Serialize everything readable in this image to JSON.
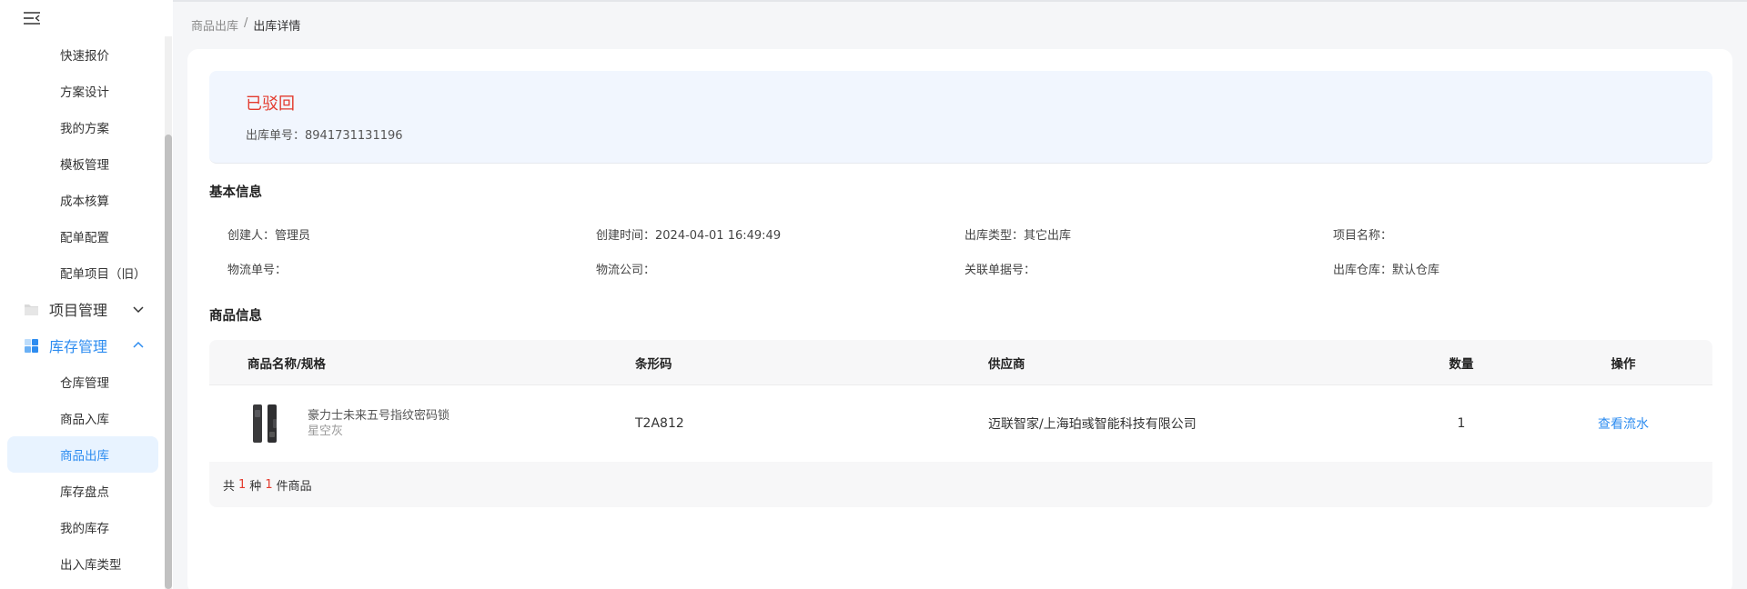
{
  "sidebar": {
    "items_top": [
      {
        "label": "快速报价"
      },
      {
        "label": "方案设计"
      },
      {
        "label": "我的方案"
      },
      {
        "label": "模板管理"
      },
      {
        "label": "成本核算"
      },
      {
        "label": "配单配置"
      },
      {
        "label": "配单项目（旧）"
      }
    ],
    "group_project": {
      "label": "项目管理",
      "icon": "folder-icon"
    },
    "group_inventory": {
      "label": "库存管理",
      "icon": "grid-icon"
    },
    "items_inventory": [
      {
        "label": "仓库管理"
      },
      {
        "label": "商品入库"
      },
      {
        "label": "商品出库"
      },
      {
        "label": "库存盘点"
      },
      {
        "label": "我的库存"
      },
      {
        "label": "出入库类型"
      }
    ]
  },
  "breadcrumb": {
    "parent": "商品出库",
    "separator": "/",
    "current": "出库详情"
  },
  "status": {
    "text": "已驳回",
    "order_label": "出库单号：",
    "order_no": "8941731131196"
  },
  "basic_info": {
    "title": "基本信息",
    "row1": [
      {
        "label": "创建人：",
        "value": "管理员"
      },
      {
        "label": "创建时间：",
        "value": "2024-04-01 16:49:49"
      },
      {
        "label": "出库类型：",
        "value": "其它出库"
      },
      {
        "label": "项目名称：",
        "value": ""
      }
    ],
    "row2": [
      {
        "label": "物流单号：",
        "value": ""
      },
      {
        "label": "物流公司：",
        "value": ""
      },
      {
        "label": "关联单据号：",
        "value": ""
      },
      {
        "label": "出库仓库：",
        "value": "默认仓库"
      }
    ]
  },
  "goods_info": {
    "title": "商品信息",
    "headers": {
      "name": "商品名称/规格",
      "barcode": "条形码",
      "supplier": "供应商",
      "qty": "数量",
      "action": "操作"
    },
    "rows": [
      {
        "name": "豪力士未来五号指纹密码锁",
        "spec": "星空灰",
        "barcode": "T2A812",
        "supplier": "迈联智家/上海珀彧智能科技有限公司",
        "qty": "1",
        "action": "查看流水"
      }
    ],
    "footer": {
      "prefix": "共",
      "kinds": "1",
      "mid": "种",
      "count": "1",
      "suffix": "件商品"
    }
  },
  "colors": {
    "accent": "#2d8cf0",
    "danger": "#e33b2e"
  }
}
